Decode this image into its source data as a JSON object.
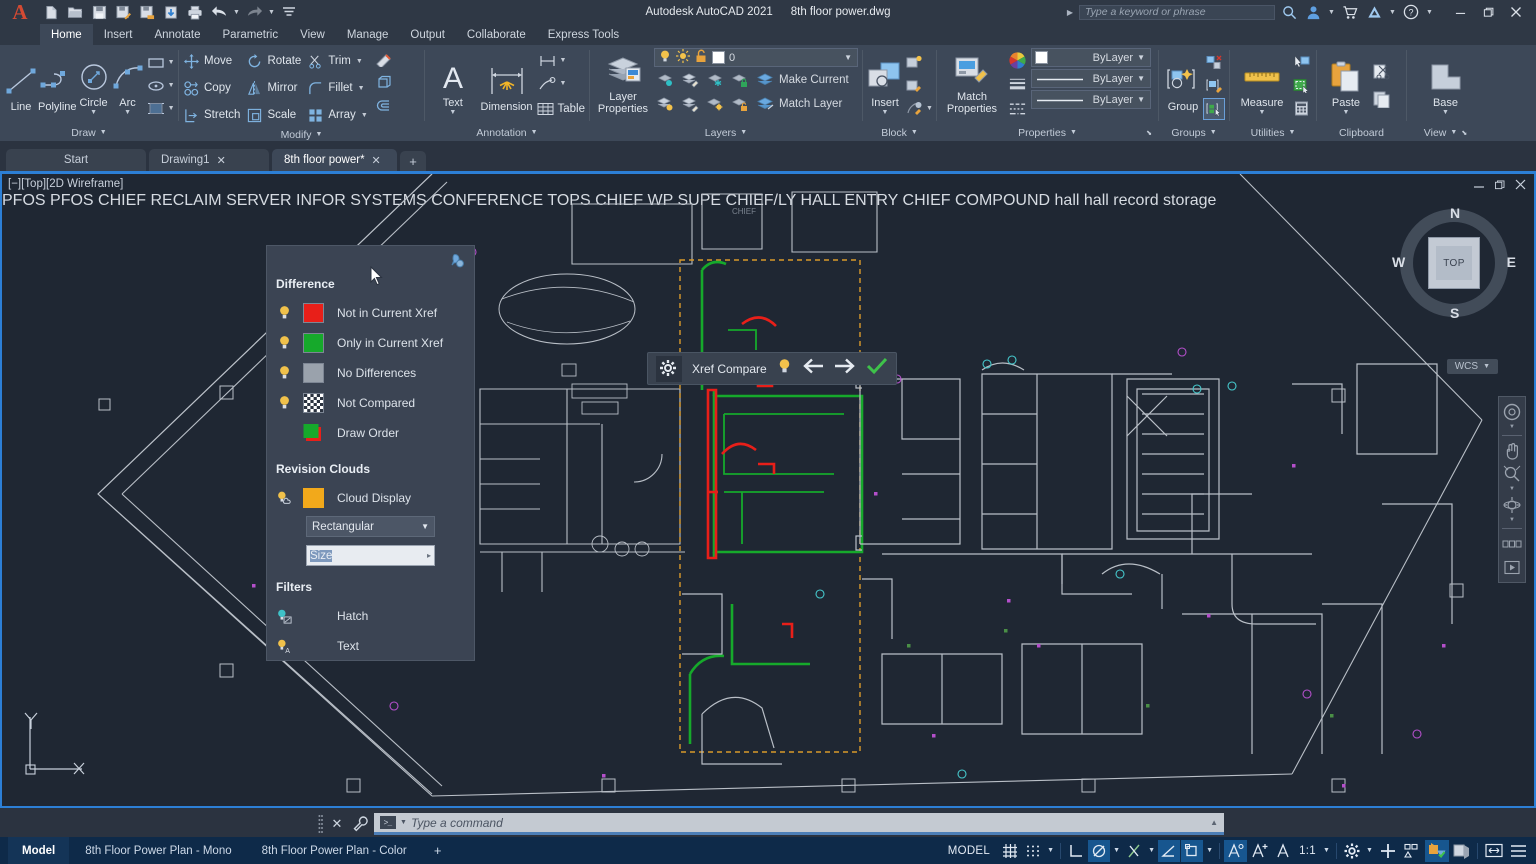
{
  "titlebar": {
    "app_title": "Autodesk AutoCAD 2021",
    "file_title": "8th floor power.dwg",
    "quick_access": [
      {
        "name": "new-file",
        "icon": "new-file-icon"
      },
      {
        "name": "open-file",
        "icon": "open-folder-icon"
      },
      {
        "name": "save",
        "icon": "save-icon"
      },
      {
        "name": "save-as",
        "icon": "save-as-icon"
      },
      {
        "name": "save-to-web",
        "icon": "save-cloud-icon"
      },
      {
        "name": "export",
        "icon": "export-icon"
      },
      {
        "name": "plot",
        "icon": "printer-icon"
      },
      {
        "name": "undo",
        "icon": "undo-icon"
      },
      {
        "name": "redo",
        "icon": "redo-icon"
      },
      {
        "name": "customize-qat",
        "icon": "chevron-down-icon"
      }
    ],
    "search_placeholder": "Type a keyword or phrase",
    "icons": [
      "search-icon",
      "user-account-icon",
      "cart-icon",
      "autodesk-a-icon",
      "help-icon"
    ],
    "window_buttons": [
      "minimize",
      "restore",
      "close"
    ]
  },
  "ribbon": {
    "tabs": [
      {
        "label": "Home",
        "active": true
      },
      {
        "label": "Insert",
        "active": false
      },
      {
        "label": "Annotate",
        "active": false
      },
      {
        "label": "Parametric",
        "active": false
      },
      {
        "label": "View",
        "active": false
      },
      {
        "label": "Manage",
        "active": false
      },
      {
        "label": "Output",
        "active": false
      },
      {
        "label": "Collaborate",
        "active": false
      },
      {
        "label": "Express Tools",
        "active": false
      }
    ],
    "panels": {
      "draw": {
        "title": "Draw",
        "big": [
          {
            "label": "Line",
            "icon": "line-icon"
          },
          {
            "label": "Polyline",
            "icon": "polyline-icon"
          },
          {
            "label": "Circle",
            "icon": "circle-icon",
            "caret": true
          },
          {
            "label": "Arc",
            "icon": "arc-icon",
            "caret": true
          }
        ],
        "small": [
          {
            "name": "rectangle",
            "icon": "rectangle-icon"
          },
          {
            "name": "ellipse",
            "icon": "ellipse-icon"
          },
          {
            "name": "hatch",
            "icon": "hatch-icon"
          }
        ]
      },
      "modify": {
        "title": "Modify",
        "items": [
          {
            "label": "Move",
            "icon": "move-icon"
          },
          {
            "label": "Rotate",
            "icon": "rotate-icon"
          },
          {
            "label": "Trim",
            "icon": "trim-icon",
            "caret": true
          },
          {
            "label": "Copy",
            "icon": "copy-icon"
          },
          {
            "label": "Mirror",
            "icon": "mirror-icon"
          },
          {
            "label": "Fillet",
            "icon": "fillet-icon",
            "caret": true
          },
          {
            "label": "Stretch",
            "icon": "stretch-icon"
          },
          {
            "label": "Scale",
            "icon": "scale-icon"
          },
          {
            "label": "Array",
            "icon": "array-icon",
            "caret": true
          }
        ],
        "extra": [
          {
            "name": "explode",
            "icon": "explode-pencil-icon"
          },
          {
            "name": "3d-box",
            "icon": "3d-box-icon"
          },
          {
            "name": "offset",
            "icon": "offset-icon"
          }
        ]
      },
      "annotation": {
        "title": "Annotation",
        "big": [
          {
            "label": "Text",
            "icon": "text-a-icon",
            "caret": true
          },
          {
            "label": "Dimension",
            "icon": "dimension-icon"
          }
        ],
        "small": [
          {
            "label": "",
            "icon": "linear-dimension-icon",
            "caret": true
          },
          {
            "label": "",
            "icon": "leader-icon",
            "caret": true
          },
          {
            "label": "Table",
            "icon": "table-icon"
          }
        ]
      },
      "layers": {
        "title": "Layers",
        "big": {
          "label": "Layer\nProperties",
          "icon": "layer-properties-icon"
        },
        "current_layer": "0",
        "layer_state_icons": [
          "lightbulb-on-icon",
          "sun-icon",
          "unlock-icon"
        ],
        "row1": [
          "layer-isolate-icon",
          "layer-edit-icon",
          "layer-freeze-icon",
          "layer-lock-icon"
        ],
        "row2": [
          "layer-off-icon",
          "layer-merge-icon",
          "layer-thaw-icon",
          "layer-unlock-icon"
        ],
        "make_current_label": "Make Current",
        "match_layer_label": "Match Layer"
      },
      "block": {
        "title": "Block",
        "big": {
          "label": "Insert",
          "icon": "insert-block-icon",
          "caret": true
        },
        "small": [
          "create-block-icon",
          "edit-block-icon",
          "block-attributes-icon"
        ]
      },
      "properties": {
        "title": "Properties",
        "big": {
          "label": "Match\nProperties",
          "icon": "match-properties-icon"
        },
        "color_value": "ByLayer",
        "linetype_value": "ByLayer",
        "lineweight_value": "ByLayer",
        "icons": [
          "color-wheel-icon",
          "lineweight-icon",
          "linetype-icon"
        ]
      },
      "groups": {
        "title": "Groups",
        "big": {
          "label": "Group",
          "icon": "group-icon"
        },
        "small": [
          "ungroup-icon",
          "group-edit-icon",
          "group-selection-icon"
        ]
      },
      "utilities": {
        "title": "Utilities",
        "big": {
          "label": "Measure",
          "icon": "ruler-icon",
          "caret": true
        },
        "small": [
          "quick-select-icon",
          "quick-calc-area-icon",
          "calculator-icon"
        ]
      },
      "clipboard": {
        "title": "Clipboard",
        "big": {
          "label": "Paste",
          "icon": "paste-icon",
          "caret": true
        },
        "small": [
          "cut-icon",
          "copy-clip-icon"
        ]
      },
      "view": {
        "title": "View",
        "big": {
          "label": "Base",
          "icon": "base-view-icon",
          "caret": true
        }
      }
    }
  },
  "document_tabs": [
    {
      "label": "Start",
      "closable": false,
      "active": false
    },
    {
      "label": "Drawing1",
      "closable": true,
      "active": false
    },
    {
      "label": "8th floor power*",
      "closable": true,
      "active": true
    }
  ],
  "viewport": {
    "label": "[−][Top][2D Wireframe]",
    "controls": [
      "minimize-icon",
      "restore-icon",
      "close-icon"
    ],
    "viewcube": {
      "top": "TOP",
      "north": "N",
      "south": "S",
      "east": "E",
      "west": "W"
    },
    "wcs_label": "WCS",
    "navbar_icons": [
      "steering-wheel-icon",
      "pan-icon",
      "zoom-extents-icon",
      "orbit-icon",
      "showmotion-icon"
    ],
    "ucs": {
      "x": "X",
      "y": "Y"
    },
    "background_color": "#1f2733"
  },
  "xref_toolbar": {
    "settings_icon": "gear-icon",
    "title": "Xref Compare",
    "lightbulb_icon": "lightbulb-icon",
    "prev_icon": "arrow-left-icon",
    "next_icon": "arrow-right-icon",
    "accept_icon": "checkmark-icon"
  },
  "xref_panel": {
    "pin_icon": "pin-icon",
    "sections": [
      {
        "title": "Difference",
        "rows": [
          {
            "label": "Not in Current Xref",
            "color": "#e81f19",
            "bulb": true,
            "bulb_color": "#f0c14b"
          },
          {
            "label": "Only in Current Xref",
            "color": "#16a92b",
            "bulb": true,
            "bulb_color": "#f0c14b"
          },
          {
            "label": "No Differences",
            "color": "#9aa2ac",
            "bulb": true,
            "bulb_color": "#f0c14b"
          },
          {
            "label": "Not Compared",
            "color": "checker",
            "bulb": true,
            "bulb_color": "#f0c14b"
          },
          {
            "label": "Draw Order",
            "color": "#16a92b",
            "color2": "#e81f19",
            "bulb": false
          }
        ]
      },
      {
        "title": "Revision Clouds",
        "rows": [
          {
            "label": "Cloud Display",
            "color": "#f2a91b",
            "bulb": true,
            "bulb_color": "#f0c14b"
          }
        ],
        "shape_value": "Rectangular",
        "size_label": "Size",
        "size_value": ""
      },
      {
        "title": "Filters",
        "rows": [
          {
            "label": "Hatch",
            "icon": "hatch-filter-icon"
          },
          {
            "label": "Text",
            "icon": "text-filter-icon"
          }
        ]
      }
    ]
  },
  "command_line": {
    "placeholder": "Type a command",
    "close_icon": "close-icon",
    "wrench_icon": "wrench-icon",
    "prompt_icon": "command-prompt-icon"
  },
  "status_bar": {
    "layout_tabs": [
      {
        "label": "Model",
        "active": true
      },
      {
        "label": "8th Floor Power Plan - Mono",
        "active": false
      },
      {
        "label": "8th Floor Power Plan - Color",
        "active": false
      }
    ],
    "add_layout": "+",
    "space_label": "MODEL",
    "scale": "1:1",
    "toggles": [
      {
        "name": "grid-display",
        "icon": "grid-icon",
        "on": false
      },
      {
        "name": "snap-mode",
        "icon": "snap-dots-icon",
        "on": false
      },
      {
        "name": "ortho-mode",
        "icon": "ortho-icon",
        "on": false
      },
      {
        "name": "polar-tracking",
        "icon": "polar-icon",
        "on": true
      },
      {
        "name": "object-snap-tracking",
        "icon": "osnap-tracking-icon",
        "on": false
      },
      {
        "name": "object-snap",
        "icon": "osnap-angle-icon",
        "on": true
      },
      {
        "name": "dynamic-ucs",
        "icon": "dynamic-ucs-icon",
        "on": true
      },
      {
        "name": "annotation-visibility",
        "icon": "annotation-visibility-icon",
        "on": false
      },
      {
        "name": "autoscale",
        "icon": "autoscale-icon",
        "on": false
      },
      {
        "name": "annotation-scale",
        "icon": "annotation-scale-icon",
        "on": false
      },
      {
        "name": "workspace-switching",
        "icon": "gear-icon",
        "on": false
      },
      {
        "name": "hardware-acceleration",
        "icon": "plus-icon",
        "on": false
      },
      {
        "name": "isolate-objects",
        "icon": "isolate-objects-icon",
        "on": false
      },
      {
        "name": "units-locked",
        "icon": "units-shield-icon",
        "on": true
      },
      {
        "name": "clean-screen-toggle",
        "icon": "clean-screen-icon",
        "on": false
      },
      {
        "name": "fullscreen",
        "icon": "fullscreen-icon",
        "on": false
      },
      {
        "name": "customization",
        "icon": "hamburger-icon",
        "on": false
      }
    ]
  }
}
